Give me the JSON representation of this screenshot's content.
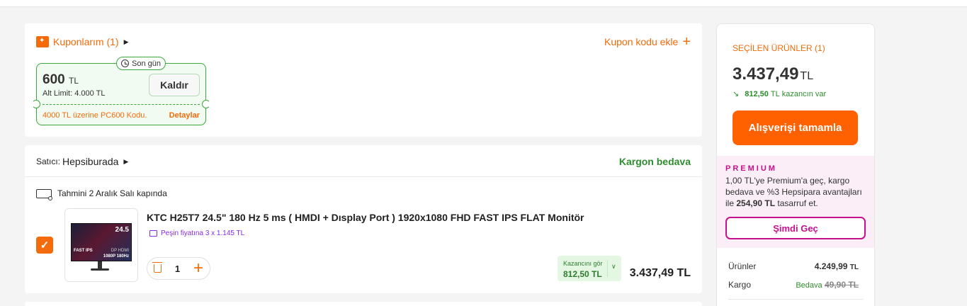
{
  "coupons": {
    "title": "Kuponlarım (1)",
    "add_label": "Kupon kodu ekle",
    "ticket": {
      "badge": "Son gün",
      "amount": "600",
      "currency": "TL",
      "min_limit": "Alt Limit: 4.000 TL",
      "remove_label": "Kaldır",
      "condition": "4000 TL üzerine PC600 Kodu.",
      "details_label": "Detaylar"
    }
  },
  "seller": {
    "label": "Satıcı:",
    "name": "Hepsiburada",
    "shipping": "Kargon bedava",
    "delivery": "Tahmini 2 Aralık Salı kapında"
  },
  "product": {
    "title": "KTC H25T7 24.5\" 180 Hz 5 ms ( HMDI + Dısplay Port ) 1920x1080 FHD FAST IPS FLAT Monitör",
    "installment": "Peşin fiyatına 3 x 1.145 TL",
    "quantity": "1",
    "earn_label": "Kazancını gör",
    "earn_value": "812,50 TL",
    "price": "3.437,49 TL",
    "image_text": {
      "size": "24.5",
      "panel": "FAST IPS",
      "res": "1080P  180Hz",
      "ports": "DP HDMI"
    }
  },
  "summary": {
    "selected_label": "SEÇİLEN ÜRÜNLER (1)",
    "total": "3.437,49",
    "currency": "TL",
    "savings_amount": "812,50",
    "savings_currency": "TL",
    "savings_suffix": "kazancın var",
    "checkout_label": "Alışverişi tamamla",
    "premium": {
      "brand": "PREMIUM",
      "text_before": "1,00 TL'ye Premium'a geç, kargo bedava ve %3 Hepsipara avantajları ile ",
      "text_bold": "254,90 TL",
      "text_after": " tasarruf et.",
      "button": "Şimdi Geç"
    },
    "rows": [
      {
        "label": "Ürünler",
        "value": "4.249,99",
        "currency": "TL"
      },
      {
        "label": "Kargo",
        "free": "Bedava",
        "old": "49,90 TL"
      }
    ]
  },
  "colors": {
    "accent": "#ff6000",
    "success": "#2e8b2e",
    "premium": "#c4128c"
  }
}
